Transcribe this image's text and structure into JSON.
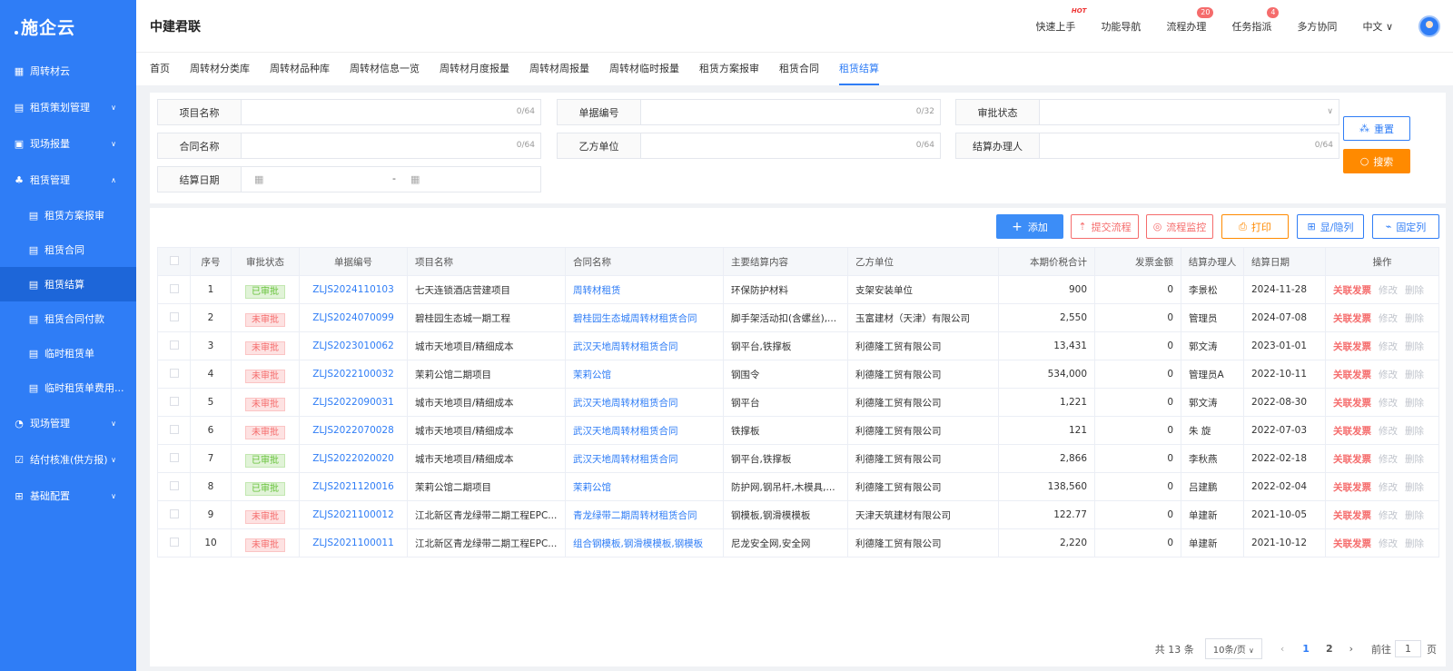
{
  "sidebar": {
    "logo": "施企云",
    "items": [
      {
        "label": "周转材云",
        "icon": "grid-icon"
      },
      {
        "label": "租赁策划管理",
        "icon": "plan-icon"
      },
      {
        "label": "现场报量",
        "icon": "report-icon"
      },
      {
        "label": "租赁管理",
        "icon": "org-icon"
      },
      {
        "label": "租赁方案报审",
        "icon": "doc-icon"
      },
      {
        "label": "租赁合同",
        "icon": "doc-icon"
      },
      {
        "label": "租赁结算",
        "icon": "doc-icon"
      },
      {
        "label": "租赁合同付款",
        "icon": "doc-icon"
      },
      {
        "label": "临时租赁单",
        "icon": "doc-icon"
      },
      {
        "label": "临时租赁单费用...",
        "icon": "doc-icon"
      },
      {
        "label": "现场管理",
        "icon": "site-icon"
      },
      {
        "label": "结付核准(供方报)",
        "icon": "check-icon"
      },
      {
        "label": "基础配置",
        "icon": "settings-icon"
      }
    ]
  },
  "header": {
    "brand": "中建君联",
    "nav": [
      "快速上手",
      "功能导航",
      "流程办理",
      "任务指派",
      "多方协同",
      "中文"
    ],
    "hot": "HOT",
    "badges": {
      "flow": "20",
      "task": "4"
    }
  },
  "tabs": [
    "首页",
    "周转材分类库",
    "周转材品种库",
    "周转材信息一览",
    "周转材月度报量",
    "周转材周报量",
    "周转材临时报量",
    "租赁方案报审",
    "租赁合同",
    "租赁结算"
  ],
  "filter": {
    "project_name": "项目名称",
    "doc_no": "单据编号",
    "approval_status": "审批状态",
    "contract_name": "合同名称",
    "party_b": "乙方单位",
    "handler": "结算办理人",
    "settle_date": "结算日期",
    "count64": "0/64",
    "count32": "0/32",
    "dash": "-",
    "reset": "重置",
    "search": "搜索"
  },
  "toolbar": {
    "add": "添加",
    "submit": "提交流程",
    "monitor": "流程监控",
    "print": "打印",
    "toggle": "显/隐列",
    "fixed": "固定列"
  },
  "table": {
    "headers": [
      "序号",
      "审批状态",
      "单据编号",
      "项目名称",
      "合同名称",
      "主要结算内容",
      "乙方单位",
      "本期价税合计",
      "发票金额",
      "结算办理人",
      "结算日期",
      "操作"
    ],
    "ops": [
      "关联发票",
      "修改",
      "删除"
    ],
    "rows": [
      {
        "no": "1",
        "status": "已审批",
        "ok": true,
        "code": "ZLJS2024110103",
        "project": "七天连锁酒店营建项目",
        "contract": "周转材租赁",
        "content": "环保防护材料",
        "party": "支架安装单位",
        "total": "900",
        "invoice": "0",
        "handler": "李景松",
        "date": "2024-11-28"
      },
      {
        "no": "2",
        "status": "未审批",
        "ok": false,
        "code": "ZLJS2024070099",
        "project": "碧桂园生态城一期工程",
        "contract": "碧桂园生态城周转材租赁合同",
        "content": "脚手架活动扣(含螺丝),...",
        "party": "玉富建材（天津）有限公司",
        "total": "2,550",
        "invoice": "0",
        "handler": "管理员",
        "date": "2024-07-08"
      },
      {
        "no": "3",
        "status": "未审批",
        "ok": false,
        "code": "ZLJS2023010062",
        "project": "城市天地项目/精细成本",
        "contract": "武汉天地周转材租赁合同",
        "content": "钢平台,铁撑板",
        "party": "利德隆工贸有限公司",
        "total": "13,431",
        "invoice": "0",
        "handler": "郭文涛",
        "date": "2023-01-01"
      },
      {
        "no": "4",
        "status": "未审批",
        "ok": false,
        "code": "ZLJS2022100032",
        "project": "茉莉公馆二期项目",
        "contract": "茉莉公馆",
        "content": "钢围令",
        "party": "利德隆工贸有限公司",
        "total": "534,000",
        "invoice": "0",
        "handler": "管理员A",
        "date": "2022-10-11"
      },
      {
        "no": "5",
        "status": "未审批",
        "ok": false,
        "code": "ZLJS2022090031",
        "project": "城市天地项目/精细成本",
        "contract": "武汉天地周转材租赁合同",
        "content": "钢平台",
        "party": "利德隆工贸有限公司",
        "total": "1,221",
        "invoice": "0",
        "handler": "郭文涛",
        "date": "2022-08-30"
      },
      {
        "no": "6",
        "status": "未审批",
        "ok": false,
        "code": "ZLJS2022070028",
        "project": "城市天地项目/精细成本",
        "contract": "武汉天地周转材租赁合同",
        "content": "铁撑板",
        "party": "利德隆工贸有限公司",
        "total": "121",
        "invoice": "0",
        "handler": "朱 旋",
        "date": "2022-07-03"
      },
      {
        "no": "7",
        "status": "已审批",
        "ok": true,
        "code": "ZLJS2022020020",
        "project": "城市天地项目/精细成本",
        "contract": "武汉天地周转材租赁合同",
        "content": "钢平台,铁撑板",
        "party": "利德隆工贸有限公司",
        "total": "2,866",
        "invoice": "0",
        "handler": "李秋燕",
        "date": "2022-02-18"
      },
      {
        "no": "8",
        "status": "已审批",
        "ok": true,
        "code": "ZLJS2021120016",
        "project": "茉莉公馆二期项目",
        "contract": "茉莉公馆",
        "content": "防护网,钢吊杆,木模具,...",
        "party": "利德隆工贸有限公司",
        "total": "138,560",
        "invoice": "0",
        "handler": "吕建鹏",
        "date": "2022-02-04"
      },
      {
        "no": "9",
        "status": "未审批",
        "ok": false,
        "code": "ZLJS2021100012",
        "project": "江北新区青龙绿带二期工程EPC...",
        "contract": "青龙绿带二期周转材租赁合同",
        "content": "钢模板,钢滑模模板",
        "party": "天津天筑建材有限公司",
        "total": "122.77",
        "invoice": "0",
        "handler": "单建新",
        "date": "2021-10-05"
      },
      {
        "no": "10",
        "status": "未审批",
        "ok": false,
        "code": "ZLJS2021100011",
        "project": "江北新区青龙绿带二期工程EPC...",
        "contract": "组合钢模板,钢滑模模板,钢模板",
        "content": "尼龙安全网,安全网",
        "party": "利德隆工贸有限公司",
        "total": "2,220",
        "invoice": "0",
        "handler": "单建新",
        "date": "2021-10-12"
      }
    ]
  },
  "pager": {
    "total": "共 13 条",
    "size": "10条/页",
    "pages": [
      "1",
      "2"
    ],
    "goto": "前往",
    "page_input": "1",
    "page_unit": "页"
  }
}
